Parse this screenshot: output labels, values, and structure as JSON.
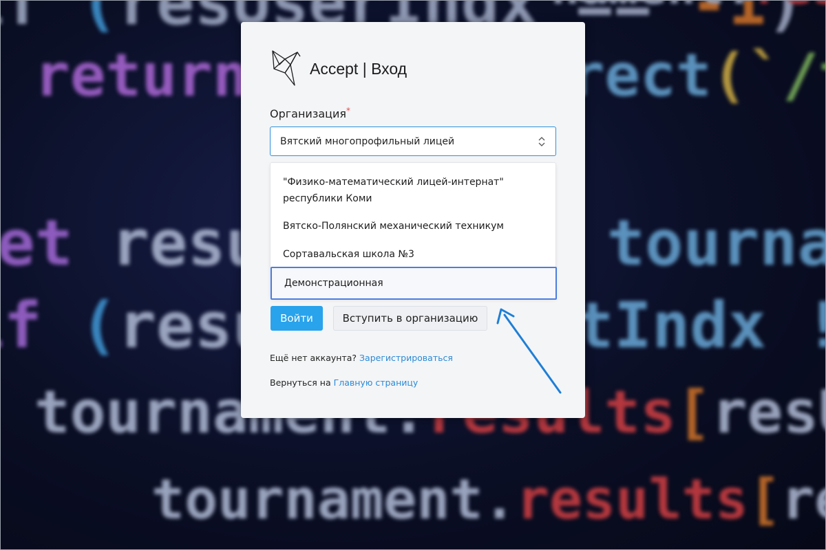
{
  "app": {
    "title": "Accept | Вход"
  },
  "form": {
    "org_label": "Организация",
    "required_mark": "*",
    "selected_value": "Вятский многопрофильный лицей"
  },
  "dropdown": {
    "options": [
      {
        "line1": "\"Физико-математический лицей-интернат\"",
        "line2": "республики Коми"
      },
      {
        "line1": "Вятско-Полянский механический техникум"
      },
      {
        "line1": "Сортавальская школа №3"
      },
      {
        "line1": "Демонстрационная",
        "highlighted": true
      }
    ]
  },
  "buttons": {
    "login": "Войти",
    "join": "Вступить в организацию"
  },
  "footer": {
    "no_account": "Ещё нет аккаунта?",
    "register_link": "Зарегистрироваться",
    "back_text": "Вернуться на",
    "home_link": "Главную страницу"
  },
  "colors": {
    "accent": "#28a3ec",
    "link": "#2a8ad6",
    "highlight_border": "#4a7ee0",
    "annotation_arrow": "#1e7fd6",
    "required": "#e34b4b"
  },
  "icons": {
    "logo": "origami-bird-icon",
    "select_toggle": "chevron-updown-icon",
    "annotation": "arrow-icon"
  }
}
